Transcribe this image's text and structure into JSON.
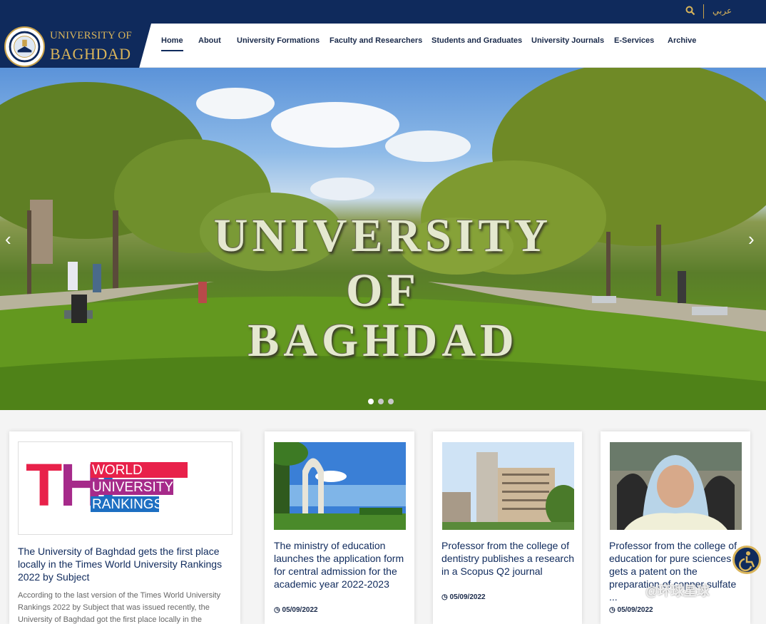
{
  "topbar": {
    "language_label": "عربي",
    "search_icon": "search-icon"
  },
  "logo": {
    "line1": "UNIVERSITY OF",
    "line2": "BAGHDAD"
  },
  "nav": [
    {
      "label": "Home"
    },
    {
      "label": "About"
    },
    {
      "label": "University Formations"
    },
    {
      "label": "Faculty and Researchers"
    },
    {
      "label": "Students and Graduates"
    },
    {
      "label": "University Journals"
    },
    {
      "label": "E-Services"
    },
    {
      "label": "Archive"
    }
  ],
  "hero": {
    "line1": "UNIVERSITY",
    "line2": "OF",
    "line3": "BAGHDAD",
    "prev_symbol": "‹",
    "next_symbol": "›",
    "slide_count": 3,
    "active_slide": 1
  },
  "cards": [
    {
      "logo_big": "THE",
      "logo_line1": "WORLD",
      "logo_line2": "UNIVERSITY",
      "logo_line3": "RANKINGS",
      "title": "The University of Baghdad gets the first place locally in the Times World University Rankings 2022 by Subject",
      "excerpt": "According to the last version of the Times World University Rankings 2022 by Subject that was issued recently, the University of Baghdad got the first place locally in the"
    },
    {
      "title": "The ministry of education launches the application form for central admission for the academic year 2022-2023",
      "date": "05/09/2022"
    },
    {
      "title": "Professor from the college of dentistry publishes a research in a Scopus Q2 journal",
      "date": "05/09/2022"
    },
    {
      "title": "Professor from the college of education for pure sciences gets a patent on the preparation of copper sulfate ...",
      "date": "05/09/2022"
    }
  ],
  "accessibility": {
    "icon": "accessibility-icon"
  },
  "watermark": "@环球星球",
  "colors": {
    "navy": "#0f2a5c",
    "gold": "#d9b45a",
    "the_red": "#e8214a",
    "the_purple": "#a62a8a",
    "the_blue": "#1d6fc2"
  }
}
